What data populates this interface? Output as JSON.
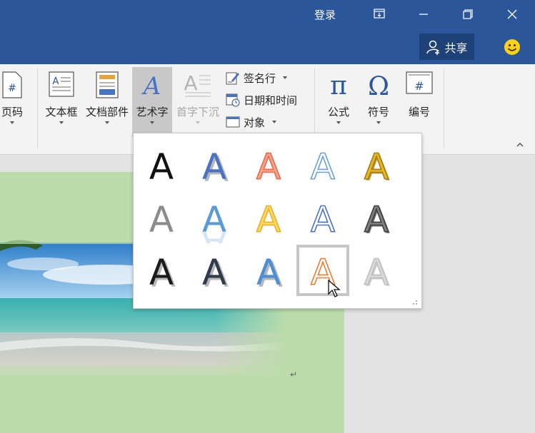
{
  "titlebar": {
    "login": "登录",
    "share": "共享"
  },
  "ribbon": {
    "page_number": "页码",
    "text_box": "文本框",
    "quick_parts": "文档部件",
    "wordart": "艺术字",
    "drop_cap": "首字下沉",
    "signature_line": "签名行",
    "date_time": "日期和时间",
    "object": "对象",
    "equation": "公式",
    "symbol": "符号",
    "number": "编号"
  },
  "gallery": {
    "styles": [
      {
        "fill": "#111111",
        "stroke": "none",
        "effect": "plain"
      },
      {
        "fill": "#4a72c4",
        "stroke": "none",
        "effect": "shadow"
      },
      {
        "fill": "#f4a48a",
        "stroke": "#e86a4a",
        "effect": "outline"
      },
      {
        "fill": "#ffffff",
        "stroke": "#6a9fd8",
        "effect": "outline"
      },
      {
        "fill": "#e7b923",
        "stroke": "#a67d12",
        "effect": "bevel"
      },
      {
        "fill": "#8c8c8c",
        "stroke": "none",
        "effect": "plain"
      },
      {
        "fill": "#5b9bd5",
        "stroke": "none",
        "effect": "reflect"
      },
      {
        "fill": "#ffd966",
        "stroke": "#e8b020",
        "effect": "outline"
      },
      {
        "fill": "#ffffff",
        "stroke": "#4a72c4",
        "effect": "outline"
      },
      {
        "fill": "#7f7f7f",
        "stroke": "#404040",
        "effect": "bevel"
      },
      {
        "fill": "#1a1a1a",
        "stroke": "none",
        "effect": "shadow"
      },
      {
        "fill": "#2f3a4a",
        "stroke": "none",
        "effect": "shadow"
      },
      {
        "fill": "#4e8ed2",
        "stroke": "none",
        "effect": "shadow"
      },
      {
        "fill": "#ffffff",
        "stroke": "#ed7d31",
        "effect": "outline"
      },
      {
        "fill": "#d9d9d9",
        "stroke": "#bfbfbf",
        "effect": "bevel"
      }
    ],
    "selected_index": 13
  }
}
